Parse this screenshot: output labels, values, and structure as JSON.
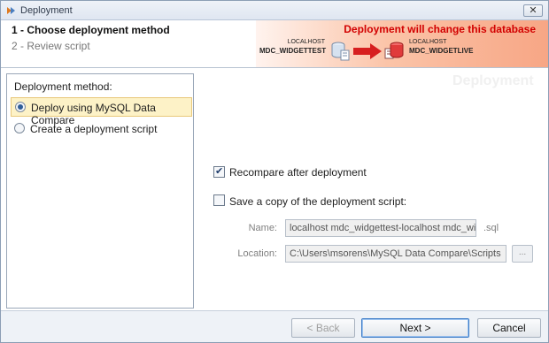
{
  "window": {
    "title": "Deployment",
    "close_label": "✕"
  },
  "header": {
    "steps": [
      "1 - Choose deployment method",
      "2 - Review script"
    ],
    "banner": {
      "warning": "Deployment will change this database",
      "source": {
        "server": "LOCALHOST",
        "database": "MDC_WIDGETTEST"
      },
      "target": {
        "server": "LOCALHOST",
        "database": "MDC_WIDGETLIVE"
      }
    },
    "colors": {
      "warning": "#d20000",
      "banner_accent": "#f7a685"
    }
  },
  "left_panel": {
    "title": "Deployment method:",
    "options": [
      {
        "label": "Deploy using MySQL Data Compare",
        "selected": true
      },
      {
        "label": "Create a deployment script",
        "selected": false
      }
    ]
  },
  "main": {
    "watermark": "Deployment",
    "recompare": {
      "label": "Recompare after deployment",
      "checked": true
    },
    "save_copy": {
      "label": "Save a copy of the deployment script:",
      "checked": false
    },
    "name": {
      "label": "Name:",
      "value": "localhost mdc_widgettest-localhost mdc_widg",
      "extension": ".sql"
    },
    "location": {
      "label": "Location:",
      "value": "C:\\Users\\msorens\\MySQL Data Compare\\Scripts",
      "browse_label": "..."
    }
  },
  "footer": {
    "back_label": "< Back",
    "next_label": "Next >",
    "cancel_label": "Cancel"
  }
}
